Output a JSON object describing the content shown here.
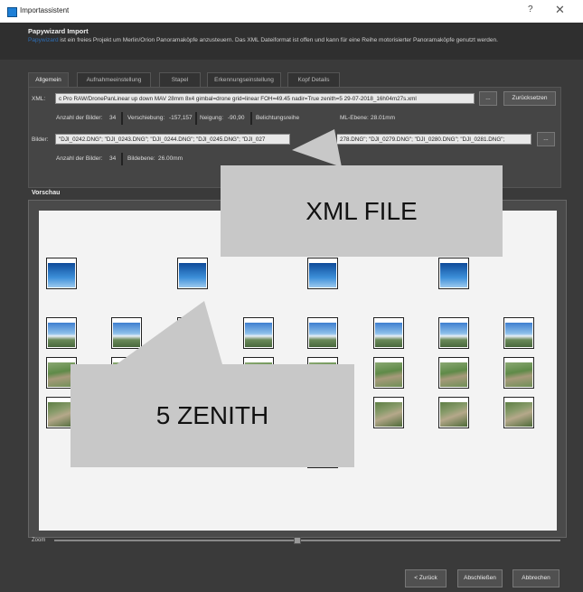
{
  "window": {
    "title": "Importassistent",
    "help": "?",
    "close": "✕"
  },
  "header": {
    "heading": "Papywizard Import",
    "link": "Papywizard",
    "description": " ist ein freies Projekt um Merlin/Orion Panoramaköpfe anzusteuern. Das XML Dateiformat ist offen und kann für eine Reihe motorisierter Panoramaköpfe genutzt werden."
  },
  "tabs": [
    "Allgemein",
    "Aufnahmeeinstellung",
    "Stapel",
    "Erkennungseinstellung",
    "Kopf Details"
  ],
  "xml": {
    "label": "XML:",
    "value": "c Pro RAW/DronePanLinear up down MAV 28mm 8x4 gimbal=drone grid=linear FOH=49.45 nadir=True zenith=5 29-07-2018_16h04m27s.xml",
    "browse": "...",
    "reset": "Zurücksetzen"
  },
  "xml_info": {
    "count_label": "Anzahl der Bilder:",
    "count_value": "34",
    "shift_label": "Verschiebung:",
    "shift_value": "-157,157",
    "tilt_label": "Neigung:",
    "tilt_value": "-90,90",
    "exp_label": "Belichtungsreihe",
    "plane_label": "ML-Ebene:",
    "plane_value": "28.01mm"
  },
  "images": {
    "label": "Bilder:",
    "value": "\"DJI_0242.DNG\"; \"DJI_0243.DNG\"; \"DJI_0244.DNG\"; \"DJI_0245.DNG\"; \"DJI_027",
    "value2": "278.DNG\"; \"DJI_0279.DNG\"; \"DJI_0280.DNG\"; \"DJI_0281.DNG\";",
    "browse": "..."
  },
  "img_info": {
    "count_label": "Anzahl der Bilder:",
    "count_value": "34",
    "plane_label": "Bildebene:",
    "plane_value": "26.00mm"
  },
  "preview": {
    "label": "Vorschau",
    "zoom_label": "Zoom",
    "zoom_level": 0.48
  },
  "callouts": {
    "xml_file": "XML FILE",
    "zenith": "5 ZENITH"
  },
  "footer": {
    "back": "< Zurück",
    "finish": "Abschließen",
    "cancel": "Abbrechen"
  },
  "thumbnails": {
    "columns": [
      [
        "sky",
        "horizon",
        "land",
        "ground"
      ],
      [
        "horizon",
        "land",
        "ground"
      ],
      [
        "sky",
        "land",
        "ground",
        "ground"
      ],
      [
        "horizon",
        "land",
        "ground"
      ],
      [
        "sky",
        "horizon",
        "land",
        "ground",
        "ground"
      ],
      [
        "horizon",
        "land",
        "ground"
      ],
      [
        "sky",
        "horizon",
        "land",
        "ground"
      ],
      [
        "horizon",
        "land",
        "ground"
      ]
    ]
  }
}
